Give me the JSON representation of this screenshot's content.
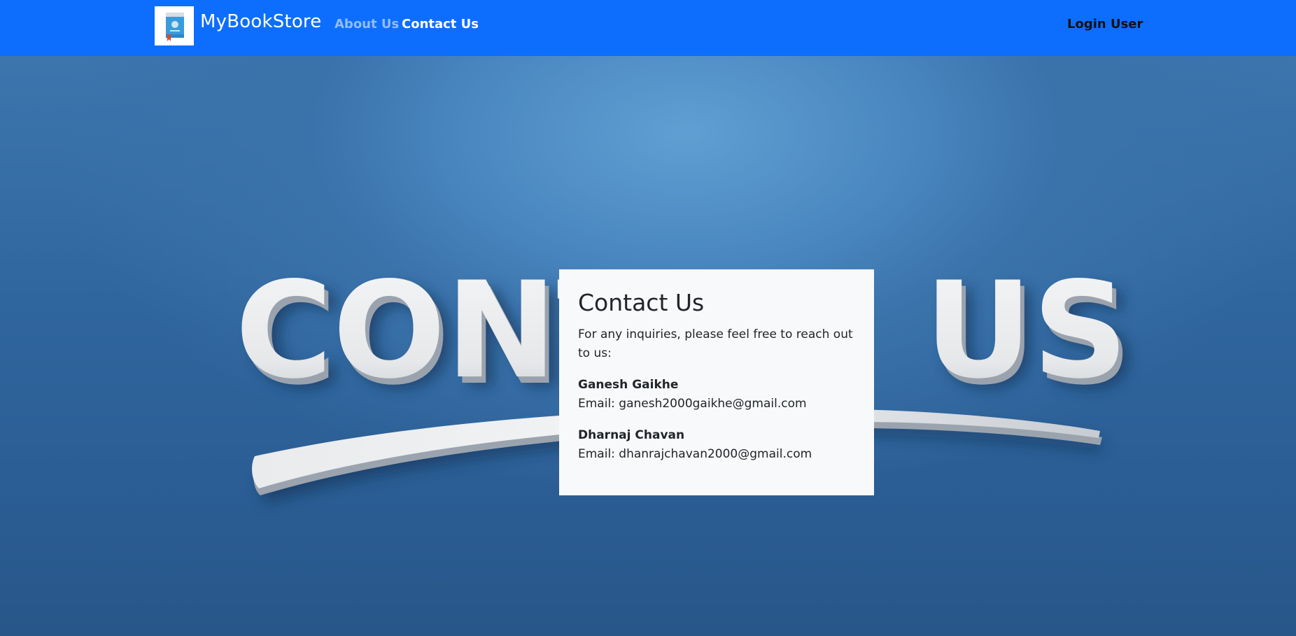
{
  "header": {
    "brand": "MyBookStore",
    "logo_icon": "book-icon",
    "nav": {
      "about": "About Us",
      "contact": "Contact Us"
    },
    "login": "Login User"
  },
  "hero": {
    "background_word_left": "CONT",
    "background_word_right": "US"
  },
  "card": {
    "title": "Contact Us",
    "intro": "For any inquiries, please feel free to reach out to us:",
    "contacts": [
      {
        "name": "Ganesh Gaikhe",
        "email": "Email: ganesh2000gaikhe@gmail.com"
      },
      {
        "name": "Dharnaj Chavan",
        "email": "Email: dhanrajchavan2000@gmail.com"
      }
    ]
  },
  "colors": {
    "navbar": "#0d6efd",
    "card": "#f8f9fa",
    "hero_bg": "#2d5f95"
  }
}
